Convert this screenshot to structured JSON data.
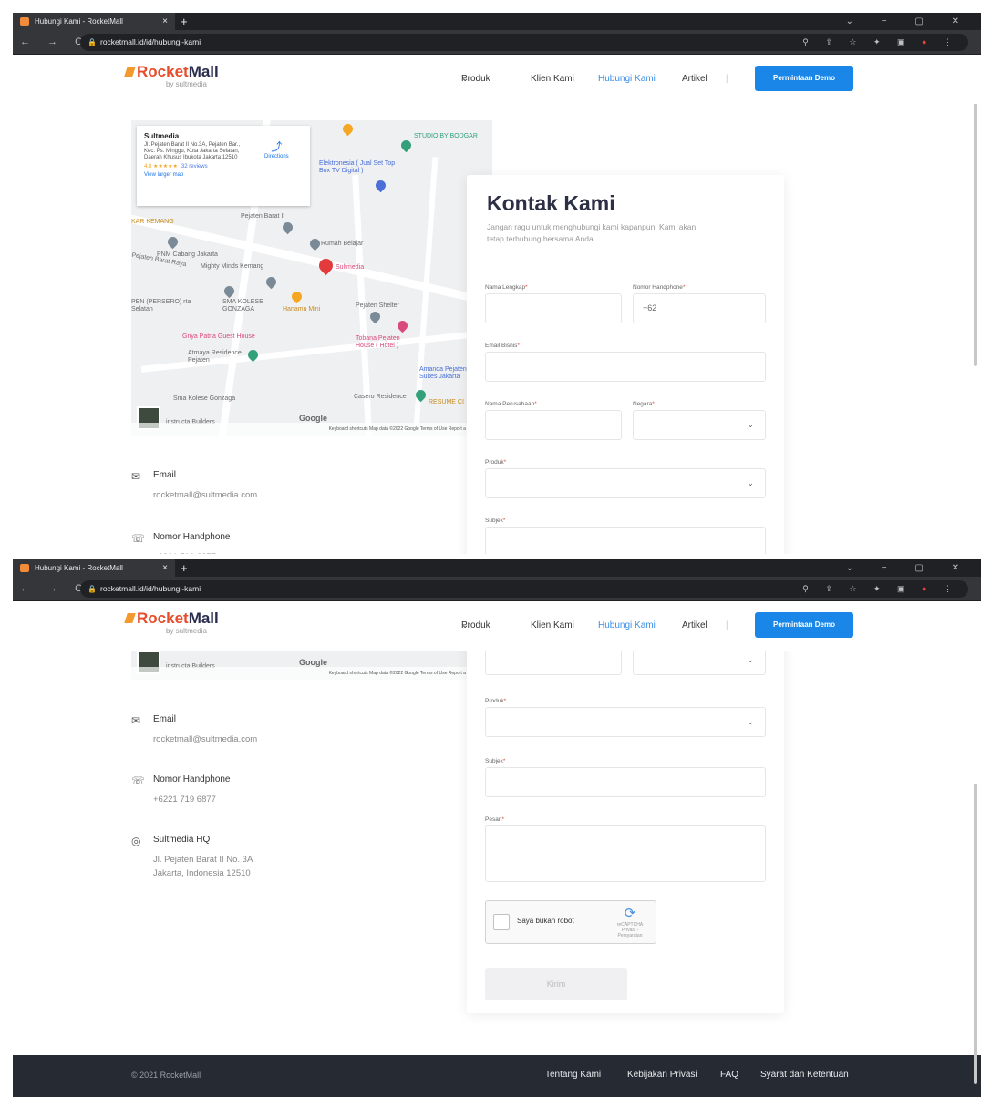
{
  "browser": {
    "tab_title": "Hubungi Kami - RocketMall",
    "tab_close": "×",
    "new_tab": "+",
    "url": "rocketmall.id/id/hubungi-kami",
    "window_controls": "⌄ − ▢ ✕"
  },
  "header": {
    "brand_rocket": "Rocket",
    "brand_mall": "Mall",
    "by_line": "by sultmedia",
    "nav": [
      "Produk",
      "Klien Kami",
      "Hubungi Kami",
      "Artikel"
    ],
    "demo_button": "Permintaan Demo"
  },
  "map": {
    "place_name": "Sultmedia",
    "address": "Jl. Pejaten Barat II No.3A, Pejaten Bar., Kec. Ps. Minggu, Kota Jakarta Selatan, Daerah Khusus Ibukota Jakarta 12510",
    "rating": "4.8 ★★★★★",
    "reviews": "32 reviews",
    "view_larger": "View larger map",
    "directions": "Directions",
    "google": "Google",
    "attribution": "Keyboard shortcuts   Map data ©2022 Google   Terms of Use   Report a map error",
    "labels": [
      "STUDIO BY BODGAR",
      "Elektronesia ( Jual Set Top Box TV Digital )",
      "Pejaten Barat II",
      "KAR KEMANG",
      "PNM Cabang Jakarta",
      "Mighty Minds Kemang",
      "Rumah Belajar",
      "Sultmedia",
      "Pejaten Barat Raya",
      "PEN (PERSERO) rta Selatan",
      "SMA KOLESE GONZAGA",
      "Hanamu Mini",
      "Pejaten Shelter",
      "Griya Patria Guest House",
      "Tobana Pejaten House ( Hotel )",
      "Atmaya Residence Pejaten",
      "Amanda Pejaten Suites Jakarta",
      "Casero Residence",
      "Sma Kolese Gonzaga",
      "instructa Builders",
      "RESUME CI"
    ]
  },
  "contact": {
    "email_label": "Email",
    "email_value": "rocketmall@sultmedia.com",
    "phone_label": "Nomor Handphone",
    "phone_value": "+6221 719 6877",
    "hq_label": "Sultmedia HQ",
    "hq_line1": "Jl. Pejaten Barat II No. 3A",
    "hq_line2": "Jakarta, Indonesia 12510"
  },
  "form": {
    "title": "Kontak Kami",
    "description": "Jangan ragu untuk menghubungi kami kapanpun. Kami akan tetap terhubung bersama Anda.",
    "full_name_label": "Nama Lengkap",
    "phone_label": "Nomor Handphone",
    "phone_prefix": "+62",
    "email_label": "Email Bisnis",
    "company_label": "Nama Perusahaan",
    "country_label": "Negara",
    "product_label": "Produk",
    "subject_label": "Subjek",
    "message_label": "Pesan",
    "required_mark": "*",
    "captcha_text": "Saya bukan robot",
    "captcha_brand": "reCAPTCHA",
    "captcha_links": "Privasi - Persyaratan",
    "submit": "Kirim"
  },
  "footer": {
    "copyright": "© 2021 RocketMall",
    "links": [
      "Tentang Kami",
      "Kebijakan Privasi",
      "FAQ",
      "Syarat dan Ketentuan"
    ]
  },
  "colors": {
    "brand_red": "#e74c2b",
    "brand_navy": "#2a2d4e",
    "accent_blue": "#1a87e8",
    "footer_bg": "#262b33"
  },
  "icons": {
    "email": "mail-icon",
    "phone": "phone-icon",
    "hq": "location-icon"
  }
}
